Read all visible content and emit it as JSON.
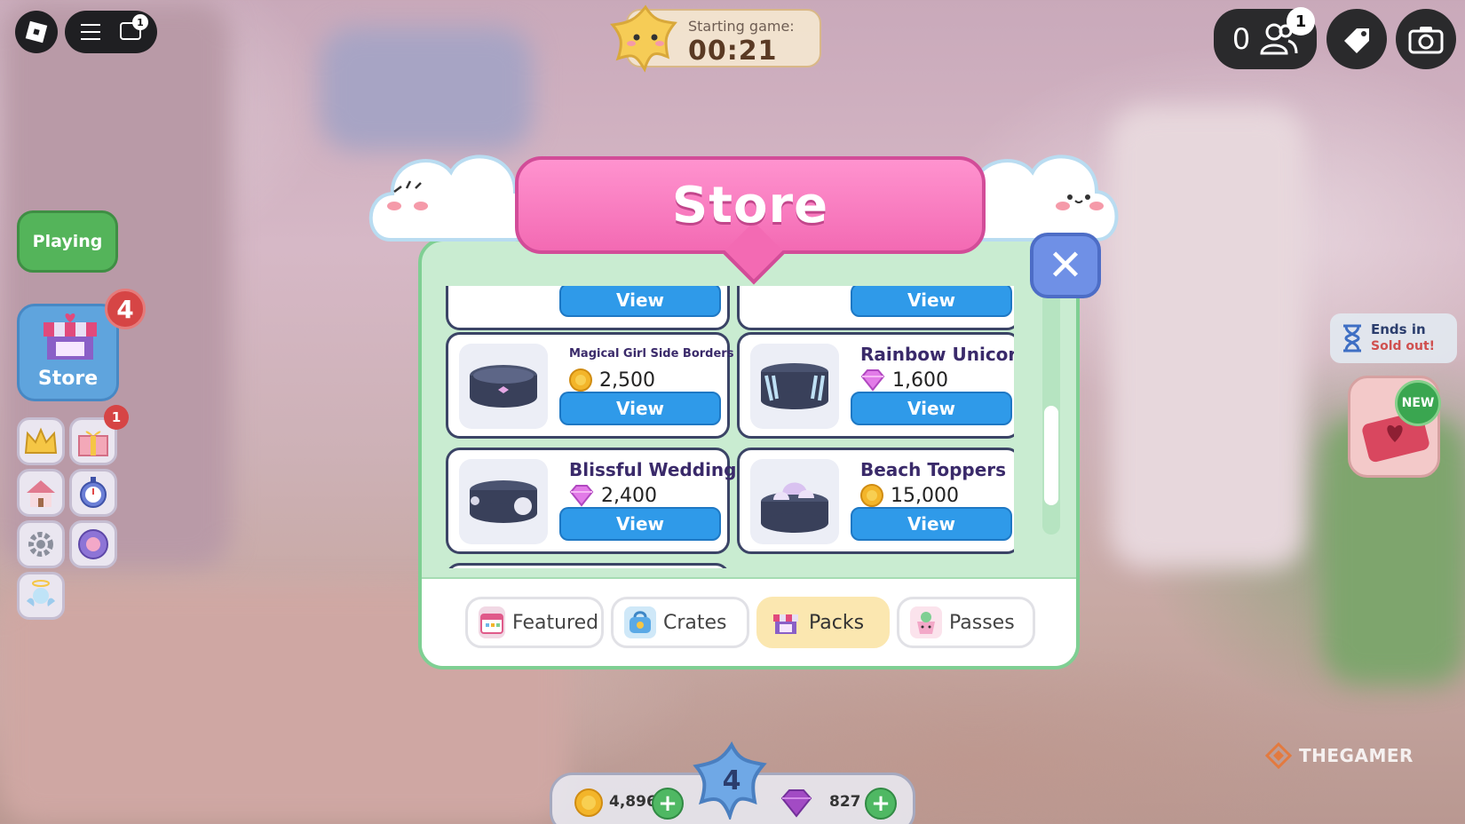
{
  "hud": {
    "timer_label": "Starting game:",
    "timer_value": "00:21",
    "player_count": "0",
    "player_badge": "1",
    "chat_badge": "1"
  },
  "left_menu": {
    "playing_label": "Playing",
    "store_label": "Store",
    "store_badge": "4",
    "gift_badge": "1"
  },
  "right_panel": {
    "ends_in_label": "Ends in",
    "sold_out_label": "Sold out!",
    "new_label": "NEW"
  },
  "store": {
    "title": "Store",
    "view_label": "View",
    "items": [
      {
        "name": "Magical Girl Side Borders",
        "price": "2,500",
        "currency": "coin"
      },
      {
        "name": "Rainbow Unicorn",
        "price": "1,600",
        "currency": "gem"
      },
      {
        "name": "Blissful Wedding",
        "price": "2,400",
        "currency": "gem"
      },
      {
        "name": "Beach Toppers",
        "price": "15,000",
        "currency": "coin"
      }
    ],
    "tabs": [
      {
        "label": "Featured",
        "icon": "calendar-icon"
      },
      {
        "label": "Crates",
        "icon": "crate-icon"
      },
      {
        "label": "Packs",
        "icon": "packs-icon",
        "active": true
      },
      {
        "label": "Passes",
        "icon": "passes-icon"
      }
    ]
  },
  "currency": {
    "coins": "4,896",
    "gems": "827",
    "level": "4"
  },
  "watermark": "THEGAMER",
  "colors": {
    "store_pink": "#f36ab3",
    "view_blue": "#2f9ae9",
    "panel_green": "#c9ecd1",
    "tab_active": "#fbe7b0"
  }
}
